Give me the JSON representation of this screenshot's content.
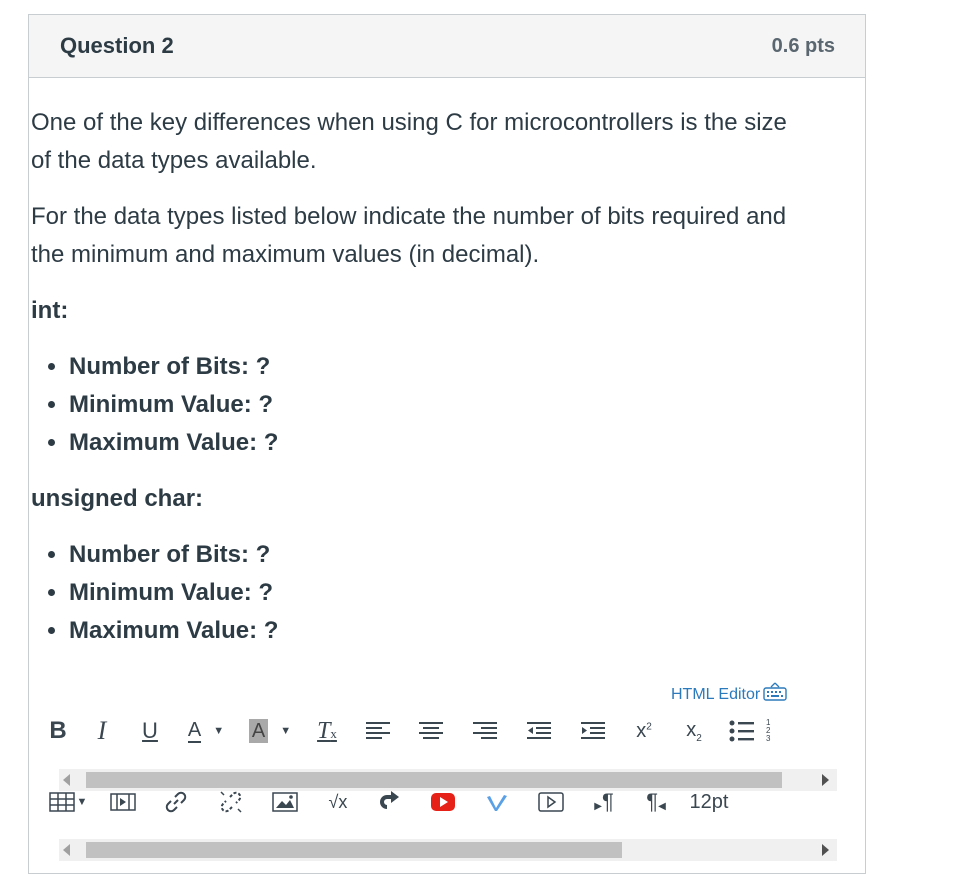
{
  "question": {
    "title": "Question 2",
    "points": "0.6 pts"
  },
  "content": {
    "para1": "One of the key differences when using C for microcontrollers is the size of the data types available.",
    "para2": "For the data types listed below indicate the number of bits required and the minimum and maximum values (in decimal).",
    "sections": [
      {
        "heading": "int:",
        "items": [
          "Number of Bits:  ?",
          "Minimum Value: ?",
          "Maximum Value: ?"
        ]
      },
      {
        "heading": "unsigned char:",
        "items": [
          "Number of Bits:  ?",
          "Minimum Value: ?",
          "Maximum Value: ?"
        ]
      }
    ]
  },
  "editor": {
    "html_editor_label": "HTML Editor",
    "font_size": "12pt",
    "toolbar1": [
      "bold",
      "italic",
      "underline",
      "text-color",
      "background-color",
      "clear-formatting",
      "align-left",
      "align-center",
      "align-right",
      "outdent",
      "indent",
      "superscript",
      "subscript",
      "bullet-list",
      "numbered-list"
    ],
    "toolbar2": [
      "table",
      "media",
      "link",
      "unlink",
      "image",
      "equation",
      "embed",
      "youtube",
      "vimeo",
      "video",
      "ltr",
      "rtl",
      "font-size"
    ],
    "colors": {
      "accent": "#2b7abc",
      "youtube": "#e62117",
      "vimeo": "#5aa0e6"
    }
  }
}
